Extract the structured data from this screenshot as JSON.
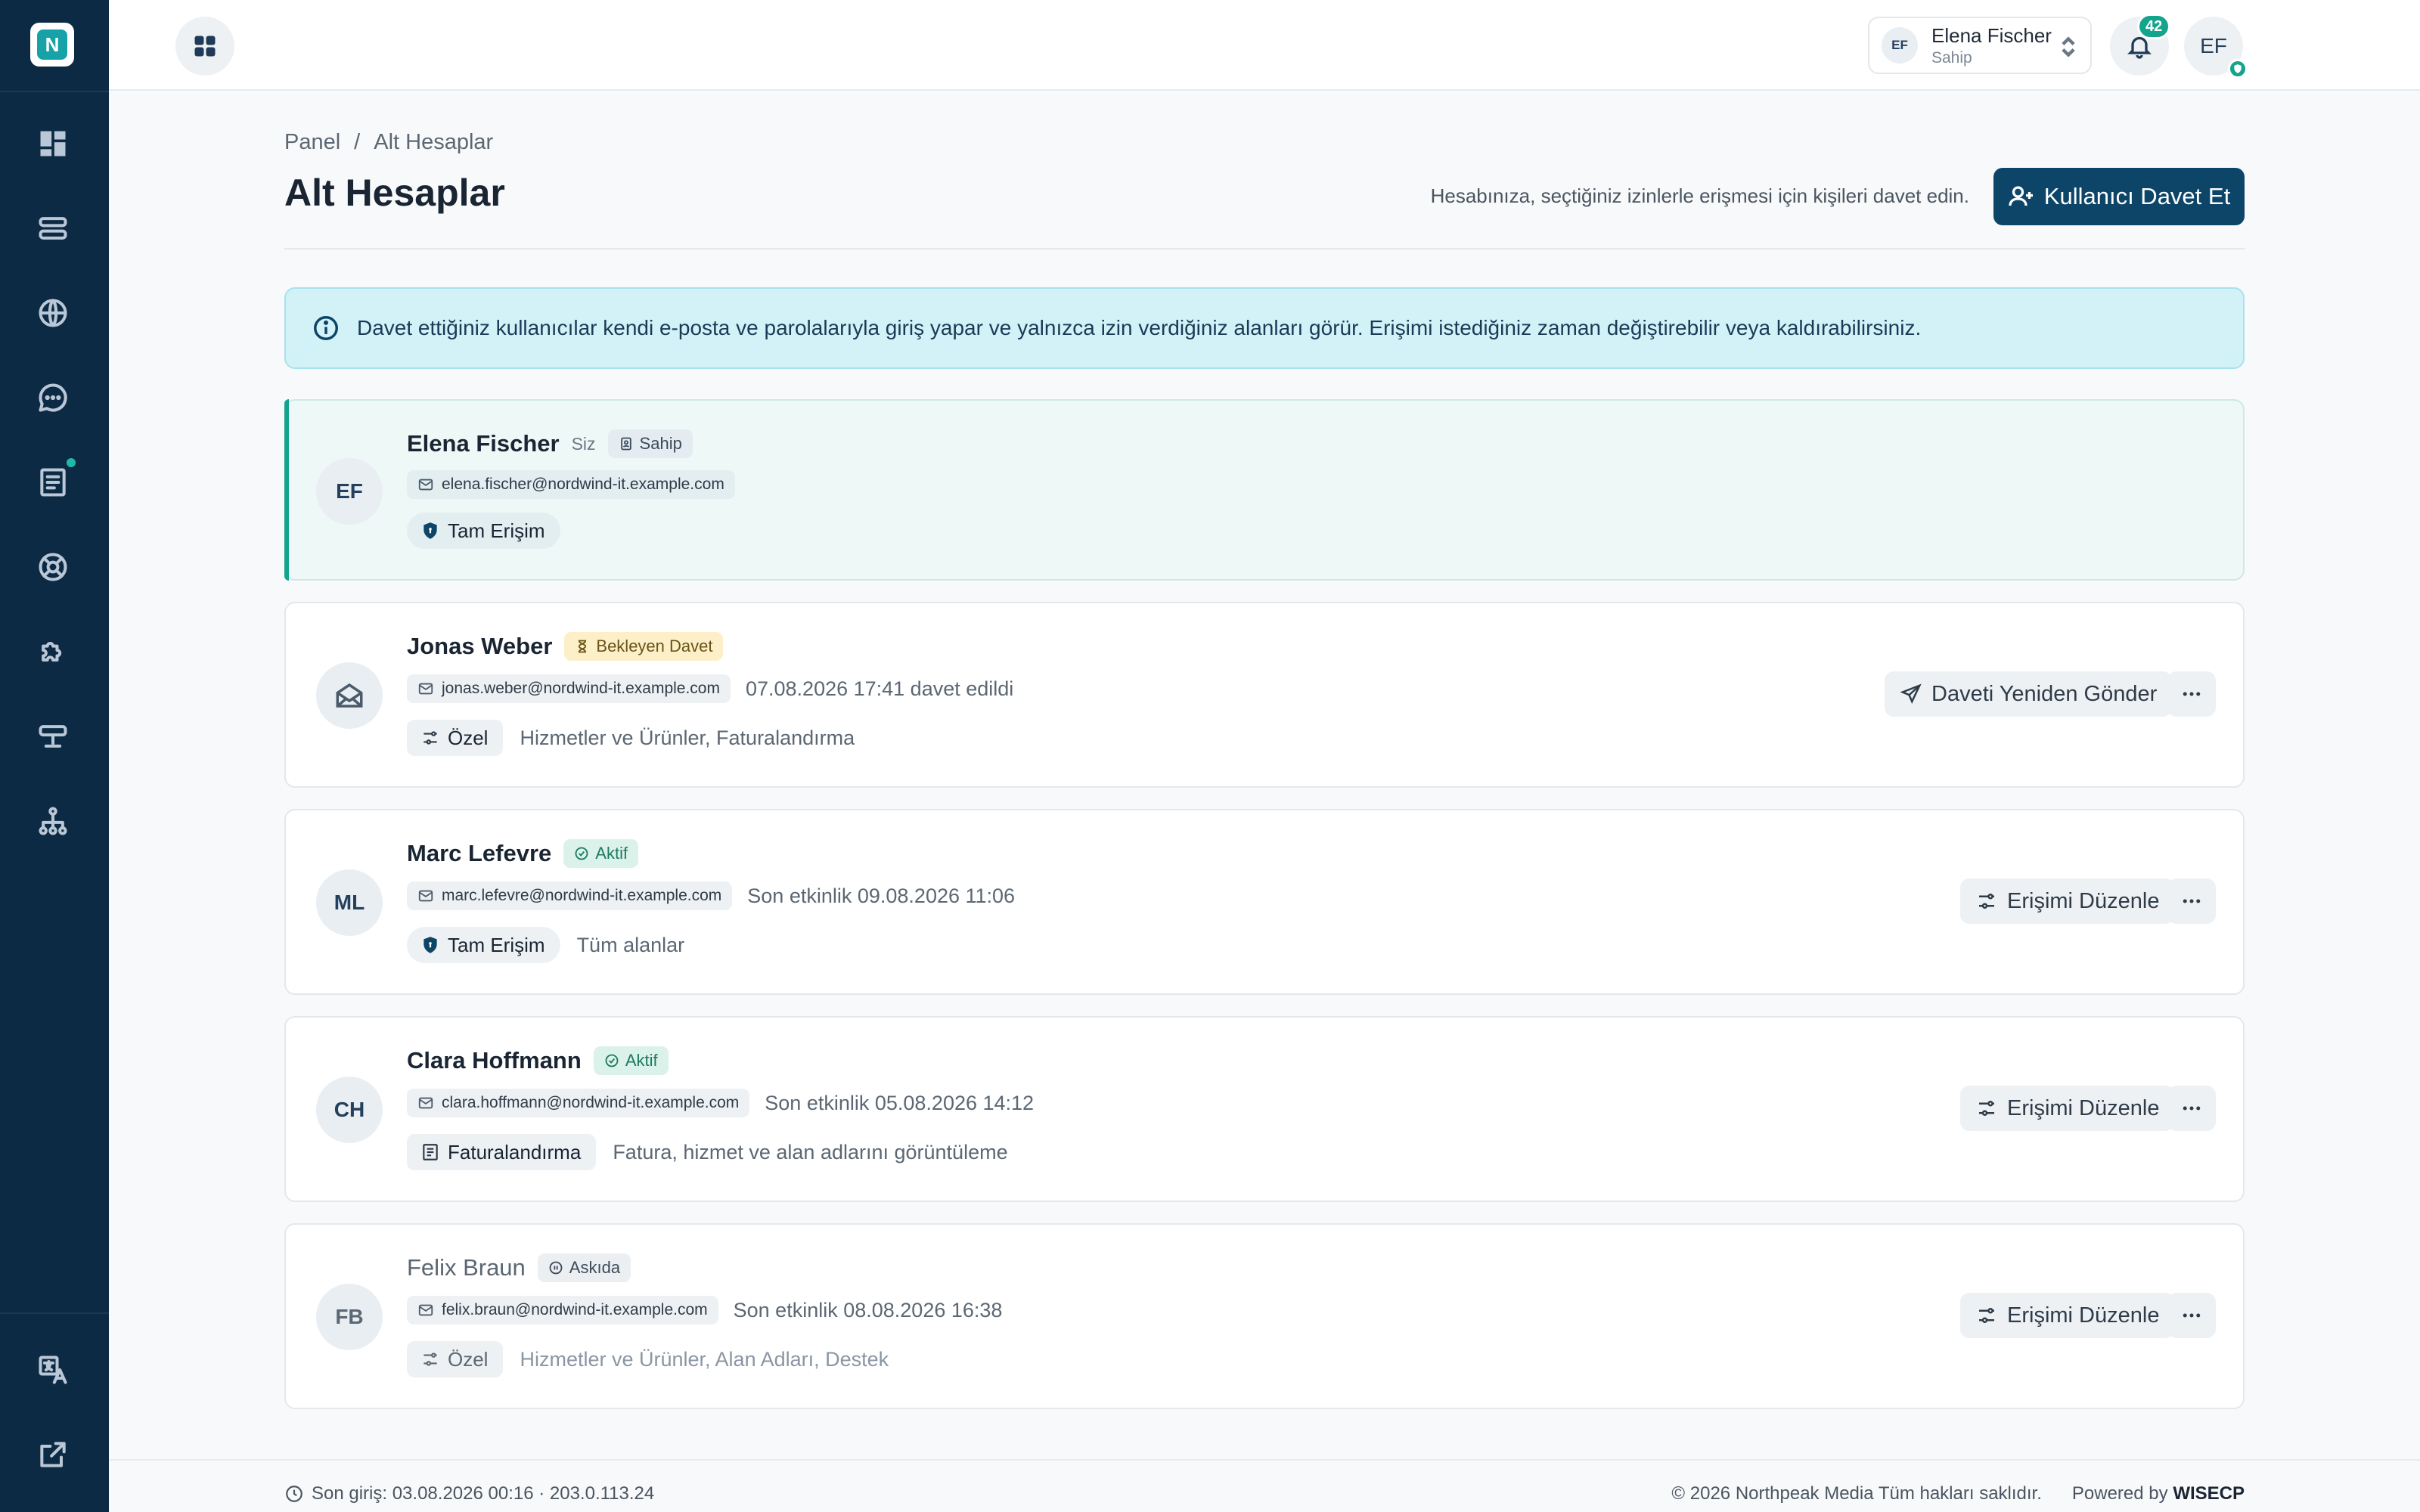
{
  "app": {
    "logo_letter": "N"
  },
  "topbar": {
    "account": {
      "initials": "EF",
      "name": "Elena Fischer",
      "role": "Sahip"
    },
    "notifications": {
      "count": "42"
    },
    "user": {
      "initials": "EF"
    }
  },
  "header": {
    "breadcrumb": [
      "Panel",
      "/",
      "Alt Hesaplar"
    ],
    "title": "Alt Hesaplar",
    "description": "Hesabınıza, seçtiğiniz izinlerle erişmesi için kişileri davet edin.",
    "invite_label": "Kullanıcı Davet Et"
  },
  "info": {
    "text": "Davet ettiğiniz kullanıcılar kendi e-posta ve parolalarıyla giriş yapar ve yalnızca izin verdiğiniz alanları görür. Erişimi istediğiniz zaman değiştirebilir veya kaldırabilirsiniz."
  },
  "users": [
    {
      "initials": "EF",
      "name": "Elena Fischer",
      "you": "Siz",
      "badge": "Sahip",
      "email": "elena.fischer@nordwind-it.example.com",
      "meta": "",
      "access": "Tam Erişim",
      "scope": "",
      "action": ""
    },
    {
      "initials": "",
      "name": "Jonas Weber",
      "you": "",
      "badge": "Bekleyen Davet",
      "email": "jonas.weber@nordwind-it.example.com",
      "meta": "07.08.2026 17:41 davet edildi",
      "access": "Özel",
      "scope": "Hizmetler ve Ürünler, Faturalandırma",
      "action": "Daveti Yeniden Gönder"
    },
    {
      "initials": "ML",
      "name": "Marc Lefevre",
      "you": "",
      "badge": "Aktif",
      "email": "marc.lefevre@nordwind-it.example.com",
      "meta": "Son etkinlik 09.08.2026 11:06",
      "access": "Tam Erişim",
      "scope": "Tüm alanlar",
      "action": "Erişimi Düzenle"
    },
    {
      "initials": "CH",
      "name": "Clara Hoffmann",
      "you": "",
      "badge": "Aktif",
      "email": "clara.hoffmann@nordwind-it.example.com",
      "meta": "Son etkinlik 05.08.2026 14:12",
      "access": "Faturalandırma",
      "scope": "Fatura, hizmet ve alan adlarını görüntüleme",
      "action": "Erişimi Düzenle"
    },
    {
      "initials": "FB",
      "name": "Felix Braun",
      "you": "",
      "badge": "Askıda",
      "email": "felix.braun@nordwind-it.example.com",
      "meta": "Son etkinlik 08.08.2026 16:38",
      "access": "Özel",
      "scope": "Hizmetler ve Ürünler, Alan Adları, Destek",
      "action": "Erişimi Düzenle"
    }
  ],
  "footer": {
    "last_login": "Son giriş: 03.08.2026 00:16 · 203.0.113.24",
    "copyright": "© 2026 Northpeak Media Tüm hakları saklıdır.",
    "powered_by": "Powered by",
    "brand": "WISECP"
  }
}
